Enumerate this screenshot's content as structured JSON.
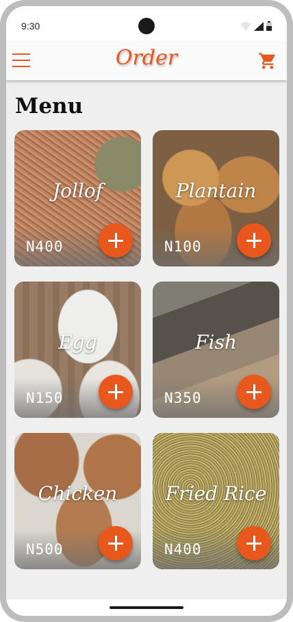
{
  "status_bar": {
    "time": "9:30"
  },
  "app_bar": {
    "title": "Order"
  },
  "page": {
    "heading": "Menu"
  },
  "items": [
    {
      "name": "Jollof",
      "price": "N400"
    },
    {
      "name": "Plantain",
      "price": "N100"
    },
    {
      "name": "Egg",
      "price": "N150"
    },
    {
      "name": "Fish",
      "price": "N350"
    },
    {
      "name": "Chicken",
      "price": "N500"
    },
    {
      "name": "Fried Rice",
      "price": "N400"
    }
  ],
  "colors": {
    "accent": "#e8581c",
    "background": "#efefef"
  },
  "icons": [
    "menu-icon",
    "cart-icon",
    "add-icon",
    "wifi-icon",
    "signal-icon",
    "battery-icon"
  ]
}
